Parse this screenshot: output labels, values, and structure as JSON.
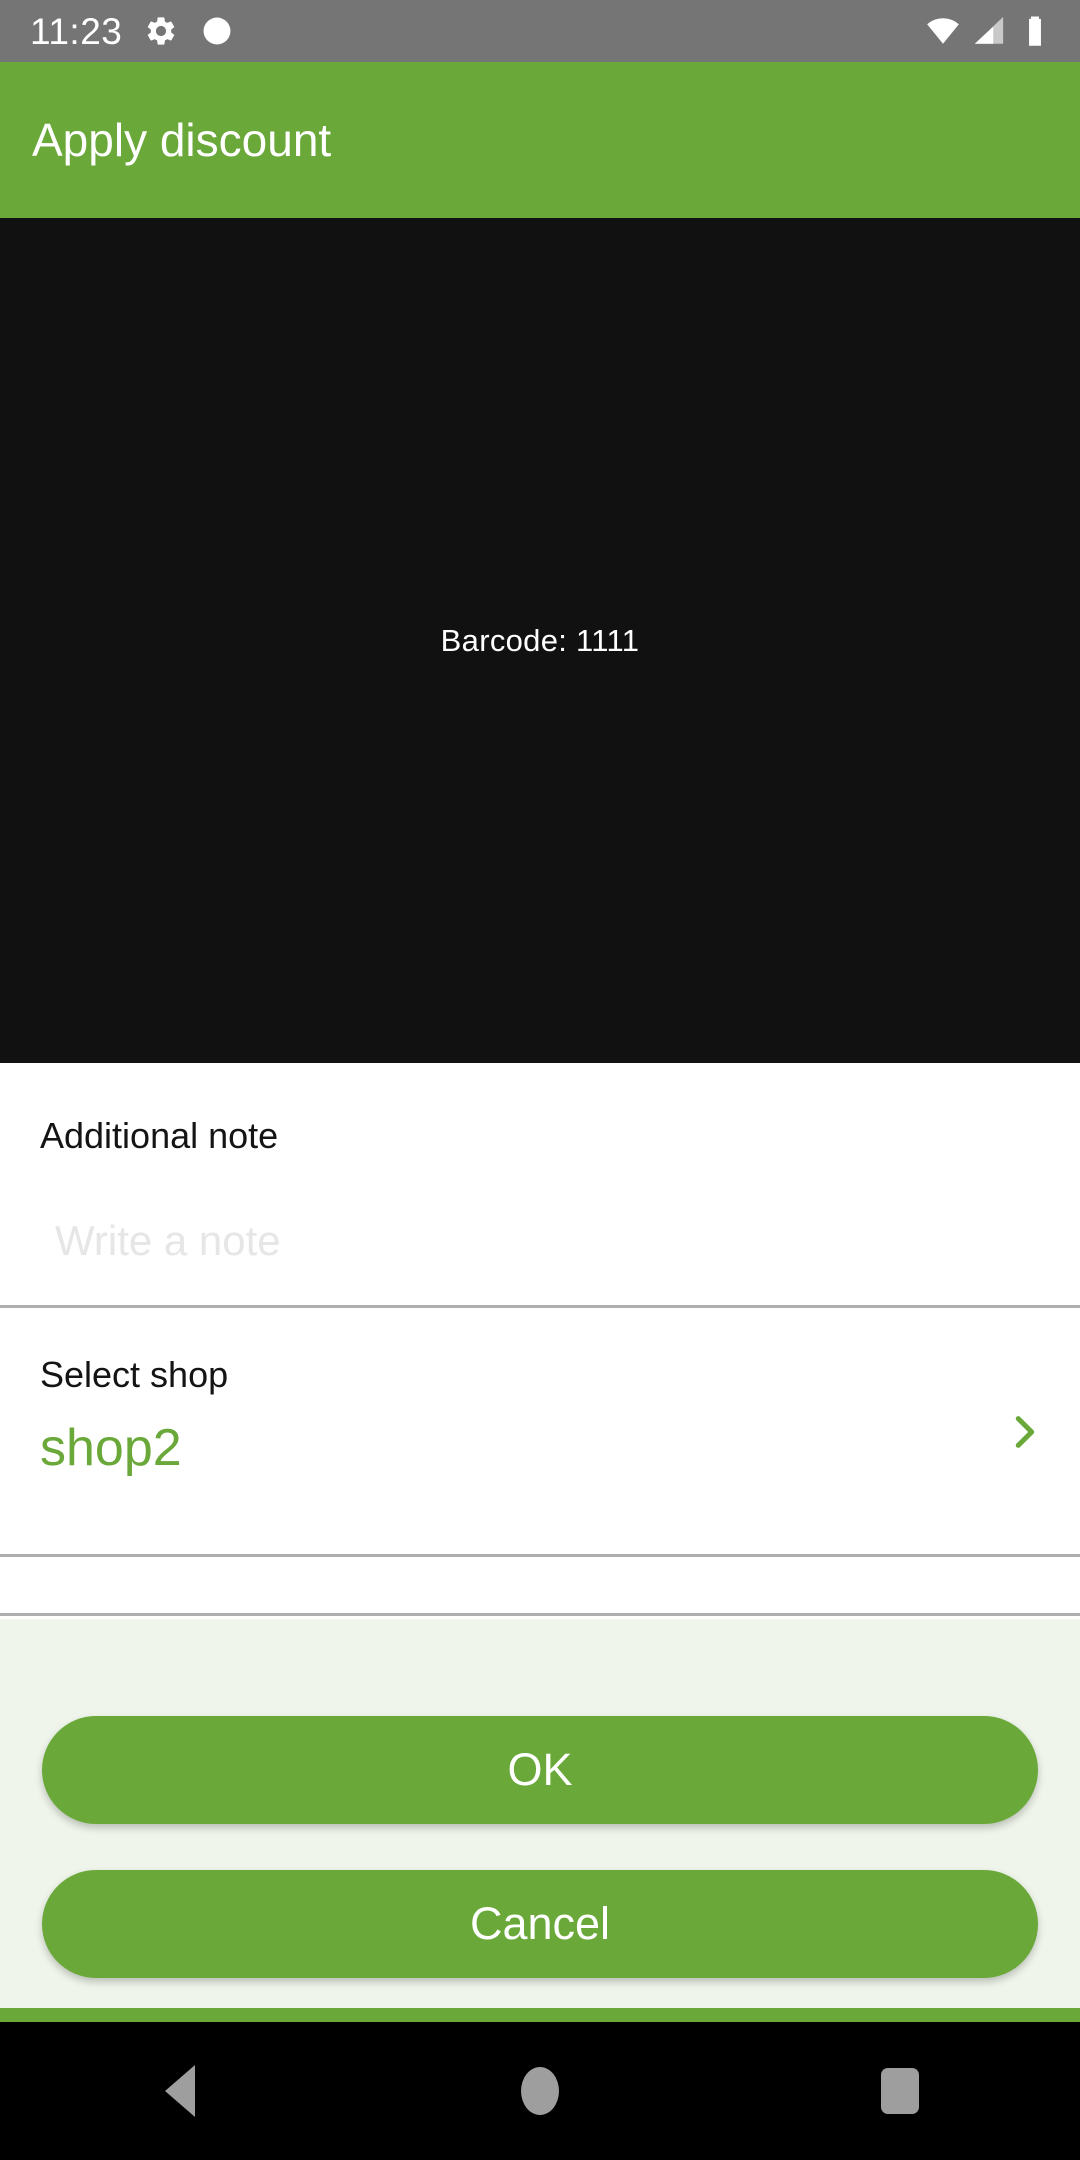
{
  "status_bar": {
    "time": "11:23",
    "icons_left": [
      "gear-icon",
      "circle-icon"
    ],
    "icons_right": [
      "wifi-icon",
      "cell-signal-icon",
      "battery-icon"
    ],
    "background_color": "#757575"
  },
  "app_bar": {
    "title": "Apply discount",
    "background_color": "#69A839",
    "text_color": "#FFFFFF"
  },
  "camera": {
    "barcode_readout": "Barcode: 1111",
    "background_color": "#111111"
  },
  "form": {
    "note": {
      "label": "Additional note",
      "value": "",
      "placeholder": "Write a note"
    },
    "shop": {
      "label": "Select shop",
      "value": "shop2",
      "value_color": "#69A839",
      "chevron_icon": "chevron-right-icon"
    }
  },
  "actions": {
    "ok_label": "OK",
    "cancel_label": "Cancel",
    "button_color": "#69A839",
    "panel_color": "#EFF5EA"
  },
  "nav_bar": {
    "back": "back-triangle-icon",
    "home": "home-circle-icon",
    "recents": "recents-square-icon",
    "background_color": "#000000",
    "icon_color": "#9E9E9E"
  }
}
